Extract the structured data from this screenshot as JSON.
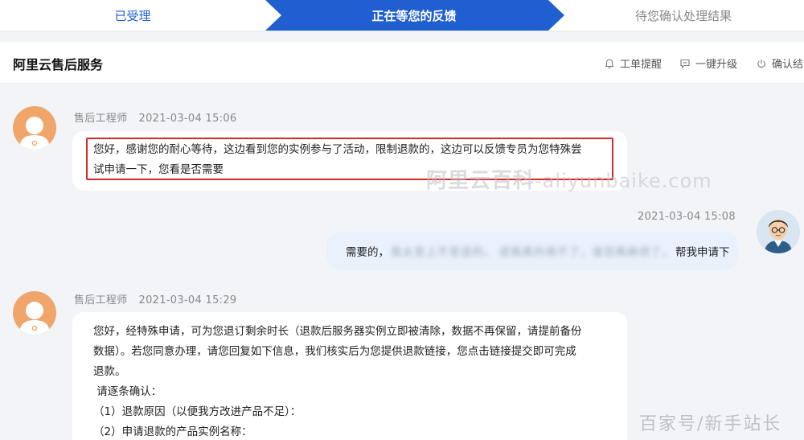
{
  "steps": {
    "step1": "已受理",
    "step2": "正在等您的反馈",
    "step3": "待您确认处理结果",
    "active_color": "#1f5fcf"
  },
  "header": {
    "title": "阿里云售后服务",
    "actions": {
      "remind": "工单提醒",
      "upgrade": "一键升级",
      "confirm": "确认结"
    }
  },
  "messages": [
    {
      "sender": "售后工程师",
      "time": "2021-03-04 15:06",
      "lines": [
        "您好，感谢您的耐心等待，这边看到您的实例参与了活动，限制退款的，这边可以反馈专员为您特殊尝",
        "试申请一下，您看是否需要"
      ]
    },
    {
      "time": "2021-03-04 15:08",
      "prefix": "需要的，",
      "blur1": "我太变上不变退的，",
      "blur2": "退我真的用不了，谁您再麻烦了。",
      "suffix": "帮我申请下"
    },
    {
      "sender": "售后工程师",
      "time": "2021-03-04 15:29",
      "lines": [
        "您好，经特殊申请，可为您退订剩余时长（退款后服务器实例立即被清除，数据不再保留，请提前备份",
        "数据）。若您同意办理，请您回复如下信息，我们核实后为您提供退款链接，您点击链接提交即可完成",
        "退款。",
        " 请逐条确认：",
        "（1）退款原因（以便我方改进产品不足）：",
        "（2）申请退款的产品实例名称："
      ]
    }
  ],
  "watermarks": {
    "main_cn": "阿里云百科",
    "main_latin": "-aliyunbaike.com",
    "corner": "百家号/新手站长"
  }
}
